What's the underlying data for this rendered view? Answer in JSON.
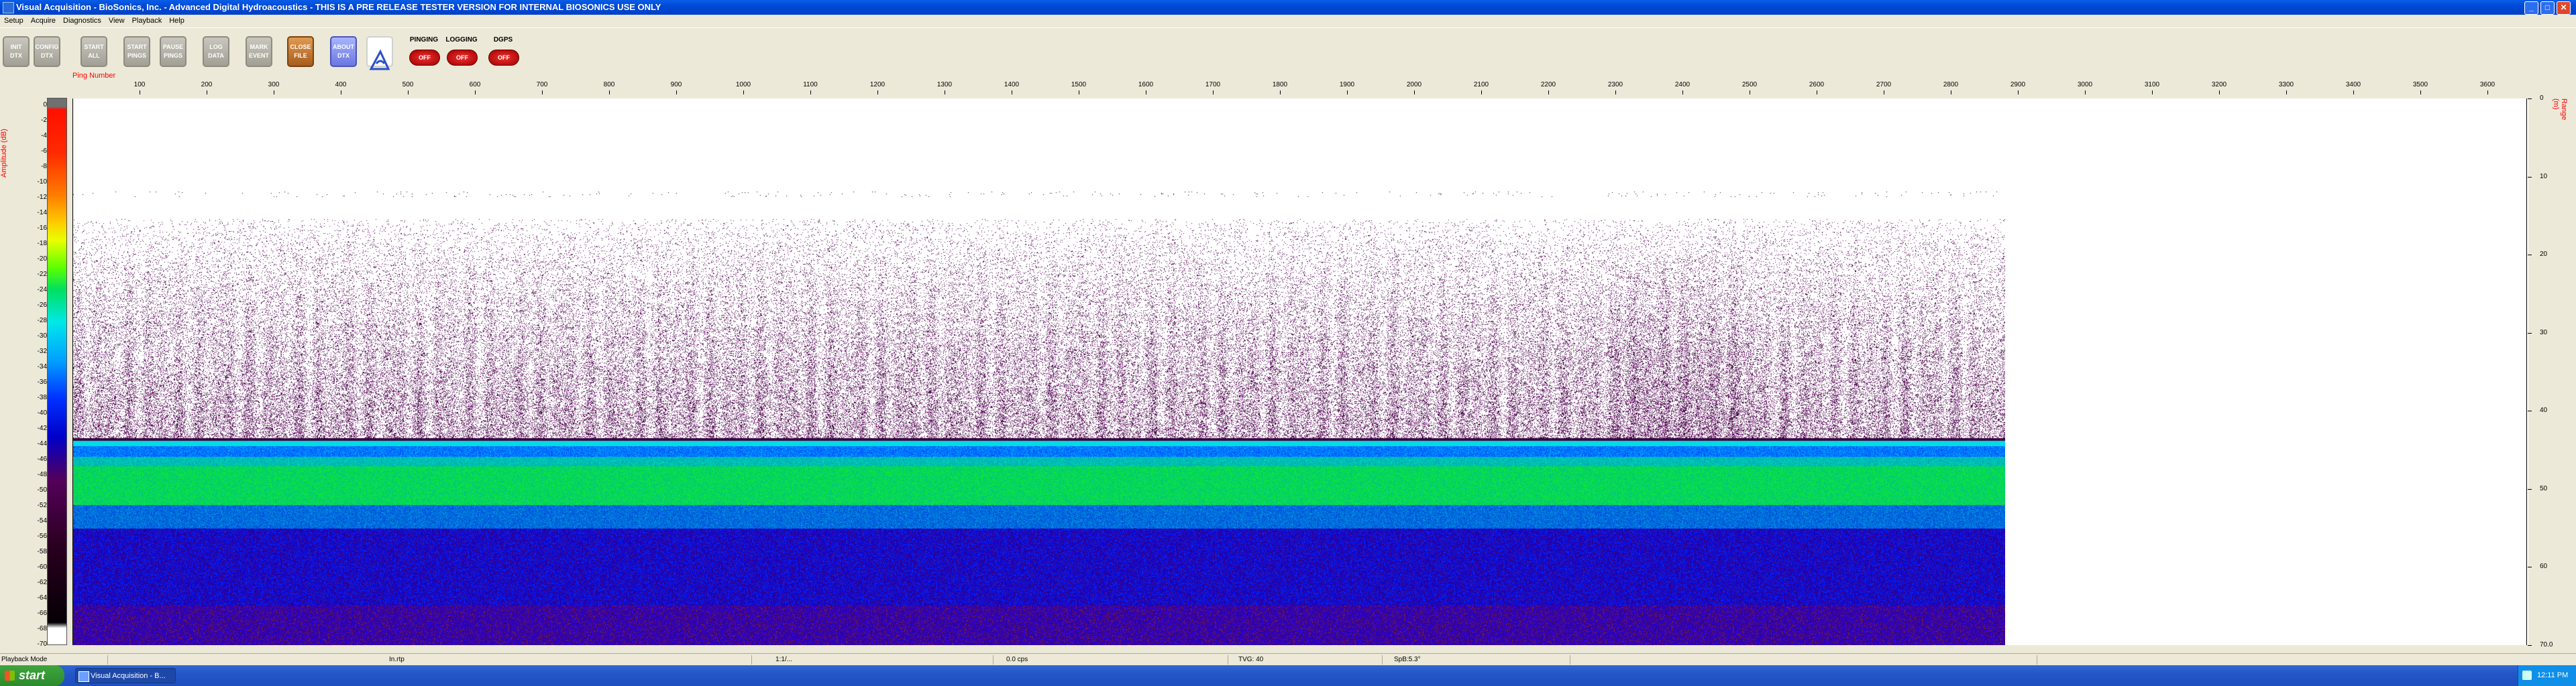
{
  "window": {
    "title": "Visual Acquisition  -  BioSonics, Inc.  -  Advanced Digital Hydroacoustics  -  THIS IS A PRE RELEASE TESTER VERSION FOR INTERNAL BIOSONICS USE ONLY",
    "controls": {
      "minimize": "_",
      "maximize": "□",
      "close": "✕"
    }
  },
  "menu": [
    "Setup",
    "Acquire",
    "Diagnostics",
    "View",
    "Playback",
    "Help"
  ],
  "toolbar": {
    "buttons": [
      {
        "name": "init-dtx-button",
        "label": "INIT\nDTX",
        "style": "gray"
      },
      {
        "name": "config-dtx-button",
        "label": "CONFIG\nDTX",
        "style": "gray"
      },
      {
        "name": "start-all-button",
        "label": "START\nALL",
        "style": "gray"
      },
      {
        "name": "start-pings-button",
        "label": "START\nPINGS",
        "style": "gray"
      },
      {
        "name": "pause-pings-button",
        "label": "PAUSE\nPINGS",
        "style": "gray"
      },
      {
        "name": "log-data-button",
        "label": "LOG\nDATA",
        "style": "gray"
      },
      {
        "name": "mark-event-button",
        "label": "MARK\nEVENT",
        "style": "gray"
      },
      {
        "name": "close-file-button",
        "label": "CLOSE\nFILE",
        "style": "orange"
      },
      {
        "name": "about-dtx-button",
        "label": "ABOUT\nDTX",
        "style": "blue"
      }
    ],
    "indicators": [
      {
        "label": "PINGING",
        "state": "OFF"
      },
      {
        "label": "LOGGING",
        "state": "OFF"
      },
      {
        "label": "DGPS",
        "state": "OFF"
      }
    ]
  },
  "echogram": {
    "ping_axis_title": "Ping Number",
    "amplitude_axis_title": "Amplitude (dB)",
    "range_axis_title": "Range (m)",
    "ping_ticks": [
      "100",
      "200",
      "300",
      "400",
      "500",
      "600",
      "700",
      "800",
      "900",
      "1000",
      "1100",
      "1200",
      "1300",
      "1400",
      "1500",
      "1600",
      "1700",
      "1800",
      "1900",
      "2000",
      "2100",
      "2200",
      "2300",
      "2400",
      "2500",
      "2600",
      "2700",
      "2800",
      "2900",
      "3000",
      "3100",
      "3200",
      "3300",
      "3400",
      "3500",
      "3600"
    ],
    "amplitude_ticks": [
      "0",
      "-2",
      "-4",
      "-6",
      "-8",
      "-10",
      "-12",
      "-14",
      "-16",
      "-18",
      "-20",
      "-22",
      "-24",
      "-26",
      "-28",
      "-30",
      "-32",
      "-34",
      "-36",
      "-38",
      "-40",
      "-42",
      "-44",
      "-46",
      "-48",
      "-50",
      "-52",
      "-54",
      "-56",
      "-58",
      "-60",
      "-62",
      "-64",
      "-66",
      "-68",
      "-70"
    ],
    "range_ticks": [
      "0",
      "10",
      "20",
      "30",
      "40",
      "50",
      "60",
      "70.0"
    ],
    "ping_max": 3660,
    "pings_recorded": 2880,
    "range_max_m": 70,
    "bottom_depth_m": 43.5,
    "colors": {
      "background": "#ffffff",
      "axis_label": "#ff0000"
    }
  },
  "statusbar": [
    "Playback Mode",
    "In.rtp",
    "1:1/...",
    "0.0 cps",
    "TVG: 40",
    "SpB:5.3°"
  ],
  "taskbar": {
    "start_label": "start",
    "task_item": "Visual Acquisition - B...",
    "clock": "12:11 PM"
  }
}
